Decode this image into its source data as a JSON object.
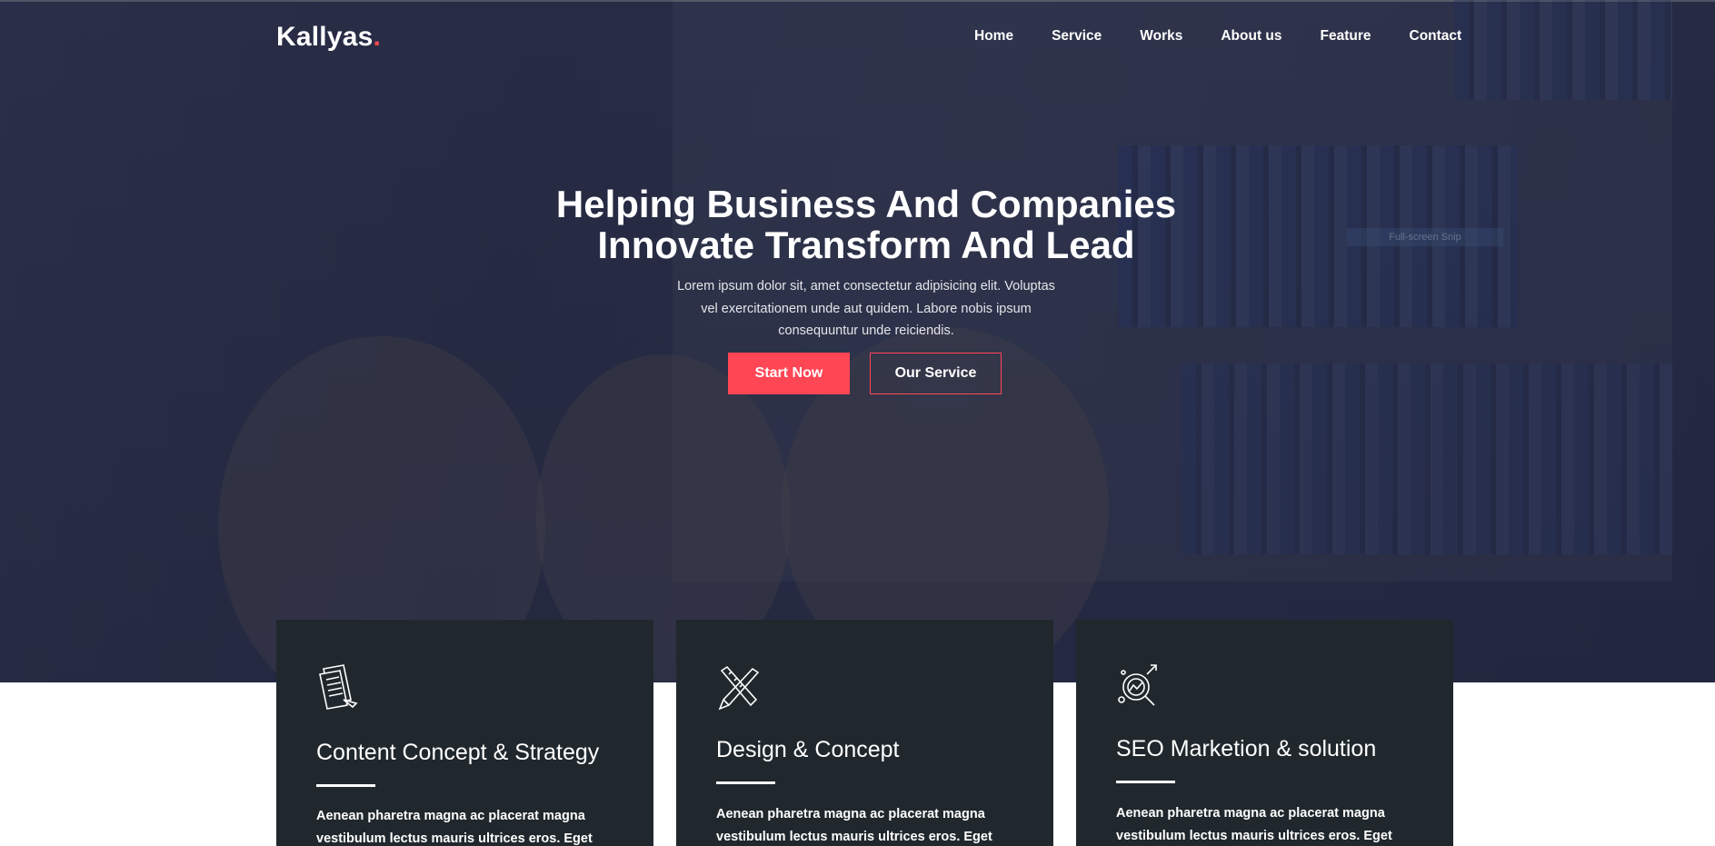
{
  "header": {
    "logo_text": "Kallyas",
    "logo_dot": ".",
    "accent_color": "#ff4655",
    "nav": [
      {
        "label": "Home"
      },
      {
        "label": "Service"
      },
      {
        "label": "Works"
      },
      {
        "label": "About us"
      },
      {
        "label": "Feature"
      },
      {
        "label": "Contact"
      }
    ]
  },
  "hero": {
    "title_line1": "Helping Business And Companies",
    "title_line2": "Innovate Transform And Lead",
    "subtitle": "Lorem ipsum dolor sit, amet consectetur adipisicing elit. Voluptas vel exercitationem unde aut quidem. Labore nobis ipsum consequuntur unde reiciendis.",
    "primary_button": "Start Now",
    "secondary_button": "Our Service",
    "overlay_label": "Full-screen Snip"
  },
  "services": [
    {
      "icon": "document-icon",
      "title": "Content Concept & Strategy",
      "text": "Aenean pharetra magna ac placerat magna vestibulum lectus mauris ultrices eros. Eget aliquet"
    },
    {
      "icon": "pencil-ruler-icon",
      "title": "Design & Concept",
      "text": "Aenean pharetra magna ac placerat magna vestibulum lectus mauris ultrices eros. Eget aliquet"
    },
    {
      "icon": "seo-magnifier-icon",
      "title": "SEO Marketion & solution",
      "text": "Aenean pharetra magna ac placerat magna vestibulum lectus mauris ultrices eros. Eget aliquet"
    }
  ]
}
